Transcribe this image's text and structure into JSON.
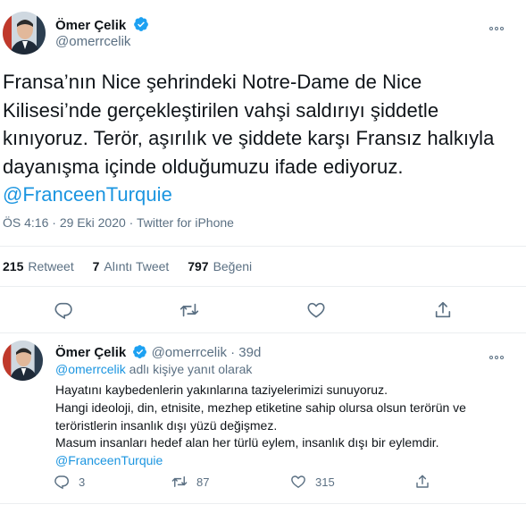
{
  "tweet": {
    "author_name": "Ömer Çelik",
    "author_handle": "@omerrcelik",
    "text_lines": [
      "Fransa’nın Nice şehrindeki Notre-Dame de Nice",
      "Kilisesi’nde gerçekleştirilen vahşi saldırıyı şiddetle",
      "kınıyoruz. Terör, aşırılık ve şiddete karşı Fransız halkıyla",
      "dayanışma içinde olduğumuzu ifade ediyoruz."
    ],
    "mention": "@FranceenTurquie",
    "time": "ÖS 4:16",
    "separator": "·",
    "date": "29 Eki 2020",
    "source": "Twitter for iPhone",
    "stats": {
      "retweets_count": "215",
      "retweets_label": "Retweet",
      "quotes_count": "7",
      "quotes_label": "Alıntı Tweet",
      "likes_count": "797",
      "likes_label": "Beğeni"
    }
  },
  "reply": {
    "author_name": "Ömer Çelik",
    "author_handle": "@omerrcelik",
    "age": "· 39d",
    "replying_to_handle": "@omerrcelik",
    "replying_to_suffix": "adlı kişiye yanıt olarak",
    "lines": [
      "Hayatını kaybedenlerin yakınlarına taziyelerimizi sunuyoruz.",
      "Hangi ideoloji, din, etnisite, mezhep etiketine sahip olursa olsun terörün ve",
      "teröristlerin insanlık dışı yüzü değişmez.",
      "Masum insanları hedef alan her türlü eylem, insanlık dışı bir eylemdir."
    ],
    "mention": "@FranceenTurquie",
    "reply_count": "3",
    "retweet_count": "87",
    "like_count": "315"
  },
  "colors": {
    "accent": "#1b95e0",
    "muted": "#5b7083",
    "text": "#0f1419",
    "divider": "#ebeef0"
  },
  "icons": [
    "verified-badge-icon",
    "more-icon",
    "reply-icon",
    "retweet-icon",
    "like-icon",
    "share-icon"
  ]
}
